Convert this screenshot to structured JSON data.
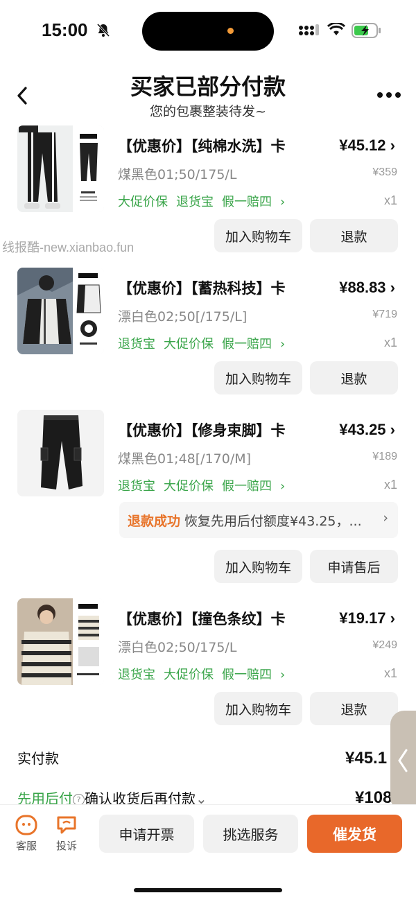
{
  "status": {
    "time": "15:00"
  },
  "header": {
    "title": "买家已部分付款",
    "subtitle": "您的包裹整装待发~"
  },
  "watermark": "线报酷-new.xianbao.fun",
  "items": [
    {
      "title": "【优惠价】【纯棉水洗】卡",
      "price": "¥45.12",
      "spec": "煤黑色01;50/175/L",
      "orig": "¥359",
      "tags": [
        "大促价保",
        "退货宝",
        "假一赔四"
      ],
      "qty": "x1",
      "btn1": "加入购物车",
      "btn2": "退款"
    },
    {
      "title": "【优惠价】【蓄热科技】卡",
      "price": "¥88.83",
      "spec": "漂白色02;50[/175/L]",
      "orig": "¥719",
      "tags": [
        "退货宝",
        "大促价保",
        "假一赔四"
      ],
      "qty": "x1",
      "btn1": "加入购物车",
      "btn2": "退款"
    },
    {
      "title": "【优惠价】【修身束脚】卡",
      "price": "¥43.25",
      "spec": "煤黑色01;48[/170/M]",
      "orig": "¥189",
      "tags": [
        "退货宝",
        "大促价保",
        "假一赔四"
      ],
      "qty": "x1",
      "refund_status": "退款成功",
      "refund_text": "恢复先用后付额度¥43.25，...",
      "btn1": "加入购物车",
      "btn2": "申请售后"
    },
    {
      "title": "【优惠价】【撞色条纹】卡",
      "price": "¥19.17",
      "spec": "漂白色02;50/175/L",
      "orig": "¥249",
      "tags": [
        "退货宝",
        "大促价保",
        "假一赔四"
      ],
      "qty": "x1",
      "btn1": "加入购物车",
      "btn2": "退款"
    }
  ],
  "summary": {
    "paid_label": "实付款",
    "paid_value": "¥45.1",
    "bnpl_label": "先用后付",
    "bnpl_text": "确认收货后再付款",
    "bnpl_value": "¥108"
  },
  "bottom": {
    "service": "客服",
    "complain": "投诉",
    "invoice": "申请开票",
    "pick_service": "挑选服务",
    "urge": "催发货"
  },
  "colors": {
    "accent": "#e8682a",
    "tag_green": "#3aa54a"
  }
}
